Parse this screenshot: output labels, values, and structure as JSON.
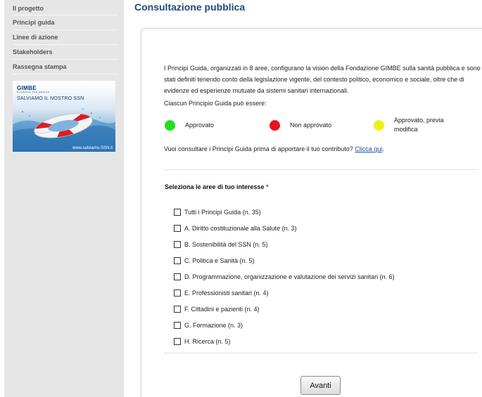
{
  "sidebar": {
    "nav_items": [
      {
        "label": "Il progetto"
      },
      {
        "label": "Principi guida"
      },
      {
        "label": "Linee di azione"
      },
      {
        "label": "Stakeholders"
      },
      {
        "label": "Rassegna stampa"
      }
    ],
    "banner": {
      "logo": "GIMBE",
      "logo_sub": "EVIDENCE FOR HEALTH",
      "slogan": "SALVIAMO IL NOSTRO SSN",
      "url": "www.salviamo-SSN.it"
    }
  },
  "main": {
    "title": "Consultazione pubblica",
    "intro": "I Principi Guida, organizzati in 8 aree, configurano la vision della Fondazione GIMBE sulla sanità pubblica e sono stati definiti tenendo conto della legislazione vigente, del contesto politico, economico e sociale, oltre che di evidenze ed esperienze mutuate da sistemi sanitari internazionali.",
    "subline": "Ciascun Principio Guida può essere:",
    "legend": [
      {
        "label": "Approvato",
        "color": "#22e01a"
      },
      {
        "label": "Non approvato",
        "color": "#e8141a"
      },
      {
        "label": "Approvato, previa modifica",
        "color": "#eef016"
      }
    ],
    "consult_text": "Vuoi consultare i Principi Guida prima di apportare il tuo contributo? ",
    "consult_link": "Clicca qui",
    "consult_end": ".",
    "section_label": "Seleziona le aree di tuo interesse",
    "required_mark": "*",
    "options": [
      {
        "label": "Tutti i Principi Guida (n. 35)"
      },
      {
        "label": "A. Diritto costituzionale alla Salute (n. 3)"
      },
      {
        "label": "B. Sostenibilità del SSN (n. 5)"
      },
      {
        "label": "C. Politica e Sanità (n. 5)"
      },
      {
        "label": "D. Programmazione, organizzazione e valutazione dei servizi sanitari (n. 6)"
      },
      {
        "label": "E. Professionisti sanitari (n. 4)"
      },
      {
        "label": "F. Cittadini e pazienti (n. 4)"
      },
      {
        "label": "G. Formazione (n. 3)"
      },
      {
        "label": "H. Ricerca (n. 5)"
      }
    ],
    "submit_label": "Avanti"
  }
}
